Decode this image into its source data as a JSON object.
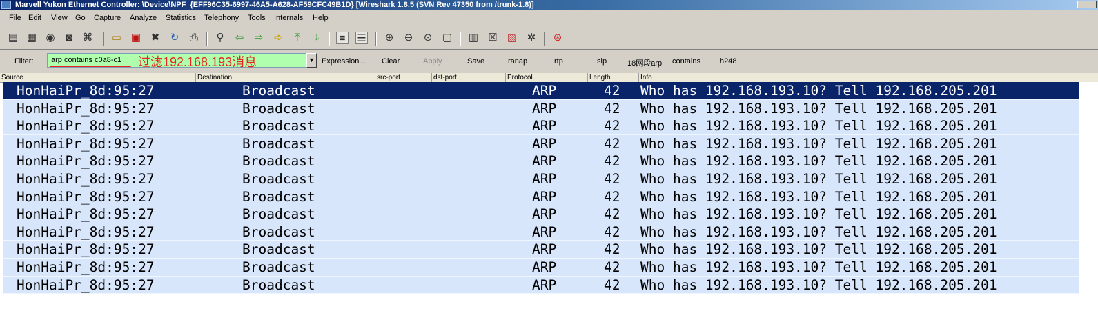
{
  "window": {
    "title": "Marvell Yukon Ethernet Controller: \\Device\\NPF_{EFF96C35-6997-46A5-A628-AF59CFC49B1D}   [Wireshark 1.8.5  (SVN Rev 47350 from /trunk-1.8)]"
  },
  "menu": [
    "File",
    "Edit",
    "View",
    "Go",
    "Capture",
    "Analyze",
    "Statistics",
    "Telephony",
    "Tools",
    "Internals",
    "Help"
  ],
  "filter": {
    "label": "Filter:",
    "value": "arp  contains  c0a8-c1",
    "note": "过滤192.168.193消息",
    "buttons": [
      "Expression...",
      "Clear",
      "Apply",
      "Save",
      "ranap",
      "rtp",
      "sip",
      "18网段arp",
      "contains",
      "h248"
    ]
  },
  "columns": [
    "Source",
    "Destination",
    "src-port",
    "dst-port",
    "Protocol",
    "Length",
    "Info"
  ],
  "packets": [
    {
      "source": "HonHaiPr_8d:95:27",
      "destination": "Broadcast",
      "protocol": "ARP",
      "length": "42",
      "info": "Who has 192.168.193.10?  Tell 192.168.205.201"
    },
    {
      "source": "HonHaiPr_8d:95:27",
      "destination": "Broadcast",
      "protocol": "ARP",
      "length": "42",
      "info": "Who has 192.168.193.10?  Tell 192.168.205.201"
    },
    {
      "source": "HonHaiPr_8d:95:27",
      "destination": "Broadcast",
      "protocol": "ARP",
      "length": "42",
      "info": "Who has 192.168.193.10?  Tell 192.168.205.201"
    },
    {
      "source": "HonHaiPr_8d:95:27",
      "destination": "Broadcast",
      "protocol": "ARP",
      "length": "42",
      "info": "Who has 192.168.193.10?  Tell 192.168.205.201"
    },
    {
      "source": "HonHaiPr_8d:95:27",
      "destination": "Broadcast",
      "protocol": "ARP",
      "length": "42",
      "info": "Who has 192.168.193.10?  Tell 192.168.205.201"
    },
    {
      "source": "HonHaiPr_8d:95:27",
      "destination": "Broadcast",
      "protocol": "ARP",
      "length": "42",
      "info": "Who has 192.168.193.10?  Tell 192.168.205.201"
    },
    {
      "source": "HonHaiPr_8d:95:27",
      "destination": "Broadcast",
      "protocol": "ARP",
      "length": "42",
      "info": "Who has 192.168.193.10?  Tell 192.168.205.201"
    },
    {
      "source": "HonHaiPr_8d:95:27",
      "destination": "Broadcast",
      "protocol": "ARP",
      "length": "42",
      "info": "Who has 192.168.193.10?  Tell 192.168.205.201"
    },
    {
      "source": "HonHaiPr_8d:95:27",
      "destination": "Broadcast",
      "protocol": "ARP",
      "length": "42",
      "info": "Who has 192.168.193.10?  Tell 192.168.205.201"
    },
    {
      "source": "HonHaiPr_8d:95:27",
      "destination": "Broadcast",
      "protocol": "ARP",
      "length": "42",
      "info": "Who has 192.168.193.10?  Tell 192.168.205.201"
    },
    {
      "source": "HonHaiPr_8d:95:27",
      "destination": "Broadcast",
      "protocol": "ARP",
      "length": "42",
      "info": "Who has 192.168.193.10?  Tell 192.168.205.201"
    },
    {
      "source": "HonHaiPr_8d:95:27",
      "destination": "Broadcast",
      "protocol": "ARP",
      "length": "42",
      "info": "Who has 192.168.193.10?  Tell 192.168.205.201"
    }
  ],
  "selected_row": 0,
  "toolbar_icons": [
    "interfaces-icon",
    "capture-options-icon",
    "start-capture-icon",
    "stop-capture-icon",
    "restart-capture-icon",
    "open-file-icon",
    "save-file-icon",
    "close-file-icon",
    "reload-icon",
    "print-icon",
    "find-icon",
    "go-back-icon",
    "go-forward-icon",
    "go-to-packet-icon",
    "go-first-icon",
    "go-last-icon",
    "colorize-icon",
    "auto-scroll-icon",
    "zoom-in-icon",
    "zoom-out-icon",
    "normal-size-icon",
    "resize-columns-icon",
    "capture-filters-icon",
    "display-filters-icon",
    "coloring-rules-icon",
    "preferences-icon",
    "help-icon"
  ],
  "colors": {
    "selected_row": "#0a246a",
    "row": "#d8e6fb",
    "filter_valid": "#afffaf",
    "annotation": "#e8241c"
  }
}
